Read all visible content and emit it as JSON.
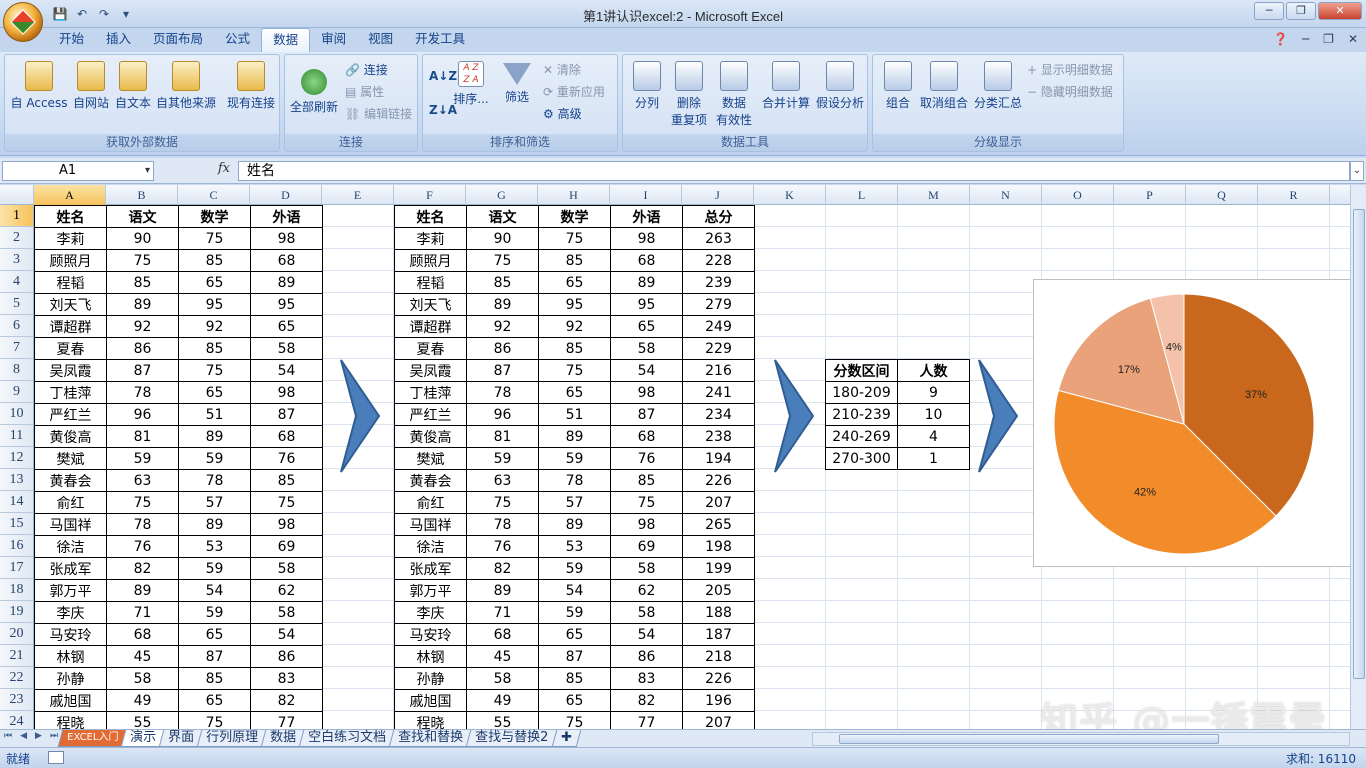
{
  "window": {
    "title": "第1讲认识excel:2 - Microsoft Excel"
  },
  "ribbon_tabs": [
    "开始",
    "插入",
    "页面布局",
    "公式",
    "数据",
    "审阅",
    "视图",
    "开发工具"
  ],
  "ribbon_active_tab": "数据",
  "ribbon": {
    "ext": {
      "label": "获取外部数据",
      "access": "自 Access",
      "web": "自网站",
      "text": "自文本",
      "other": "自其他来源",
      "existing": "现有连接"
    },
    "conn": {
      "label": "连接",
      "refresh": "全部刷新",
      "connections": "连接",
      "properties": "属性",
      "edit_links": "编辑链接"
    },
    "sort": {
      "label": "排序和筛选",
      "sort": "排序...",
      "filter": "筛选",
      "clear": "清除",
      "reapply": "重新应用",
      "advanced": "高级"
    },
    "tools": {
      "label": "数据工具",
      "split": "分列",
      "remove_dup_1": "删除",
      "remove_dup_2": "重复项",
      "valid_1": "数据",
      "valid_2": "有效性",
      "consolidate": "合并计算",
      "whatif": "假设分析"
    },
    "outline": {
      "label": "分级显示",
      "group": "组合",
      "ungroup": "取消组合",
      "subtotal": "分类汇总",
      "show_detail": "显示明细数据",
      "hide_detail": "隐藏明细数据"
    }
  },
  "formula_bar": {
    "name_box": "A1",
    "fx": "fx",
    "content": "姓名"
  },
  "columns": [
    "A",
    "B",
    "C",
    "D",
    "E",
    "F",
    "G",
    "H",
    "I",
    "J",
    "K",
    "L",
    "M",
    "N",
    "O",
    "P",
    "Q",
    "R"
  ],
  "rows": [
    "1",
    "2",
    "3",
    "4",
    "5",
    "6",
    "7",
    "8",
    "9",
    "10",
    "11",
    "12",
    "13",
    "14",
    "15",
    "16",
    "17",
    "18",
    "19",
    "20",
    "21",
    "22",
    "23",
    "24"
  ],
  "table1": {
    "headers": [
      "姓名",
      "语文",
      "数学",
      "外语"
    ],
    "rows": [
      [
        "李莉",
        "90",
        "75",
        "98"
      ],
      [
        "顾照月",
        "75",
        "85",
        "68"
      ],
      [
        "程韬",
        "85",
        "65",
        "89"
      ],
      [
        "刘天飞",
        "89",
        "95",
        "95"
      ],
      [
        "谭超群",
        "92",
        "92",
        "65"
      ],
      [
        "夏春",
        "86",
        "85",
        "58"
      ],
      [
        "吴凤霞",
        "87",
        "75",
        "54"
      ],
      [
        "丁桂萍",
        "78",
        "65",
        "98"
      ],
      [
        "严红兰",
        "96",
        "51",
        "87"
      ],
      [
        "黄俊高",
        "81",
        "89",
        "68"
      ],
      [
        "樊斌",
        "59",
        "59",
        "76"
      ],
      [
        "黄春会",
        "63",
        "78",
        "85"
      ],
      [
        "俞红",
        "75",
        "57",
        "75"
      ],
      [
        "马国祥",
        "78",
        "89",
        "98"
      ],
      [
        "徐洁",
        "76",
        "53",
        "69"
      ],
      [
        "张成军",
        "82",
        "59",
        "58"
      ],
      [
        "郭万平",
        "89",
        "54",
        "62"
      ],
      [
        "李庆",
        "71",
        "59",
        "58"
      ],
      [
        "马安玲",
        "68",
        "65",
        "54"
      ],
      [
        "林钢",
        "45",
        "87",
        "86"
      ],
      [
        "孙静",
        "58",
        "85",
        "83"
      ],
      [
        "戚旭国",
        "49",
        "65",
        "82"
      ],
      [
        "程晓",
        "55",
        "75",
        "77"
      ]
    ]
  },
  "table2": {
    "headers": [
      "姓名",
      "语文",
      "数学",
      "外语",
      "总分"
    ],
    "rows": [
      [
        "李莉",
        "90",
        "75",
        "98",
        "263"
      ],
      [
        "顾照月",
        "75",
        "85",
        "68",
        "228"
      ],
      [
        "程韬",
        "85",
        "65",
        "89",
        "239"
      ],
      [
        "刘天飞",
        "89",
        "95",
        "95",
        "279"
      ],
      [
        "谭超群",
        "92",
        "92",
        "65",
        "249"
      ],
      [
        "夏春",
        "86",
        "85",
        "58",
        "229"
      ],
      [
        "吴凤霞",
        "87",
        "75",
        "54",
        "216"
      ],
      [
        "丁桂萍",
        "78",
        "65",
        "98",
        "241"
      ],
      [
        "严红兰",
        "96",
        "51",
        "87",
        "234"
      ],
      [
        "黄俊高",
        "81",
        "89",
        "68",
        "238"
      ],
      [
        "樊斌",
        "59",
        "59",
        "76",
        "194"
      ],
      [
        "黄春会",
        "63",
        "78",
        "85",
        "226"
      ],
      [
        "俞红",
        "75",
        "57",
        "75",
        "207"
      ],
      [
        "马国祥",
        "78",
        "89",
        "98",
        "265"
      ],
      [
        "徐洁",
        "76",
        "53",
        "69",
        "198"
      ],
      [
        "张成军",
        "82",
        "59",
        "58",
        "199"
      ],
      [
        "郭万平",
        "89",
        "54",
        "62",
        "205"
      ],
      [
        "李庆",
        "71",
        "59",
        "58",
        "188"
      ],
      [
        "马安玲",
        "68",
        "65",
        "54",
        "187"
      ],
      [
        "林钢",
        "45",
        "87",
        "86",
        "218"
      ],
      [
        "孙静",
        "58",
        "85",
        "83",
        "226"
      ],
      [
        "戚旭国",
        "49",
        "65",
        "82",
        "196"
      ],
      [
        "程晓",
        "55",
        "75",
        "77",
        "207"
      ]
    ]
  },
  "table3": {
    "headers": [
      "分数区间",
      "人数"
    ],
    "rows": [
      [
        "180-209",
        "9"
      ],
      [
        "210-239",
        "10"
      ],
      [
        "240-269",
        "4"
      ],
      [
        "270-300",
        "1"
      ]
    ]
  },
  "chart_data": {
    "type": "pie",
    "categories": [
      "180-209",
      "210-239",
      "240-269",
      "270-300"
    ],
    "values": [
      9,
      10,
      4,
      1
    ],
    "labels": [
      "37%",
      "42%",
      "17%",
      "4%"
    ],
    "colors": [
      "#c9681c",
      "#f28c2a",
      "#e9a27a",
      "#f4c2aa"
    ]
  },
  "watermark": "知乎 @一锤震晕",
  "sheet_tabs": [
    "EXCEL入门",
    "演示",
    "界面",
    "行列原理",
    "数据",
    "空白练习文档",
    "查找和替换",
    "查找与替换2"
  ],
  "active_sheet_tab": "演示",
  "status": {
    "ready": "就绪",
    "sum": "求和: 16110"
  },
  "colors": {
    "accent": "#15428b",
    "selected_header": "#f7c35c",
    "arrow": "#4a7ebb"
  }
}
